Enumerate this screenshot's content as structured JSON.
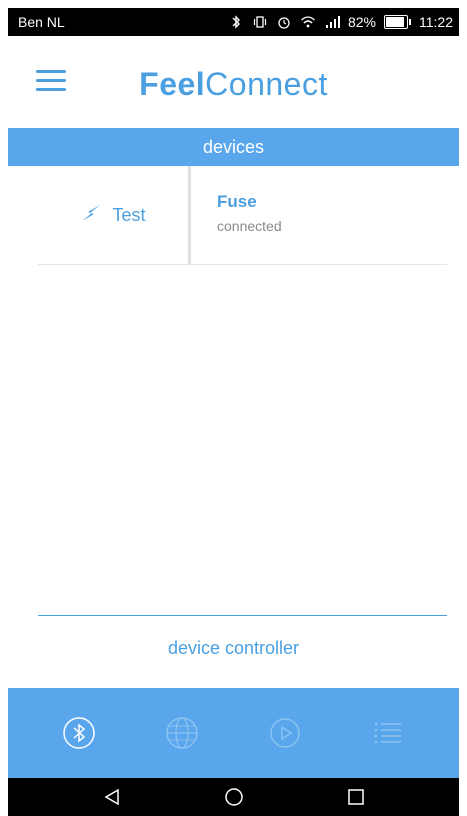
{
  "status_bar": {
    "carrier": "Ben NL",
    "battery_percent": "82%",
    "battery_level": 0.82,
    "time": "11:22",
    "icons": [
      "bluetooth-icon",
      "vibrate-icon",
      "alarm-icon",
      "wifi-icon",
      "signal-icon",
      "battery-icon"
    ]
  },
  "header": {
    "brand_strong": "Feel",
    "brand_light": "Connect",
    "menu_icon": "hamburger-menu-icon"
  },
  "section": {
    "title": "devices"
  },
  "device": {
    "left_label": "Test",
    "left_icon": "lightning-bolt-icon",
    "name": "Fuse",
    "status": "connected"
  },
  "controller": {
    "label": "device controller"
  },
  "bottom_tabs": [
    {
      "icon": "bluetooth-icon",
      "active": true
    },
    {
      "icon": "globe-icon",
      "active": false
    },
    {
      "icon": "play-icon",
      "active": false
    },
    {
      "icon": "list-icon",
      "active": false
    }
  ],
  "nav_bar": {
    "icons": [
      "back-icon",
      "home-icon",
      "recents-icon"
    ]
  },
  "colors": {
    "accent": "#4a9fe0",
    "bar": "#5aa6ec",
    "tab_active": "#ffffff",
    "tab_inactive": "#8cc3f2"
  }
}
